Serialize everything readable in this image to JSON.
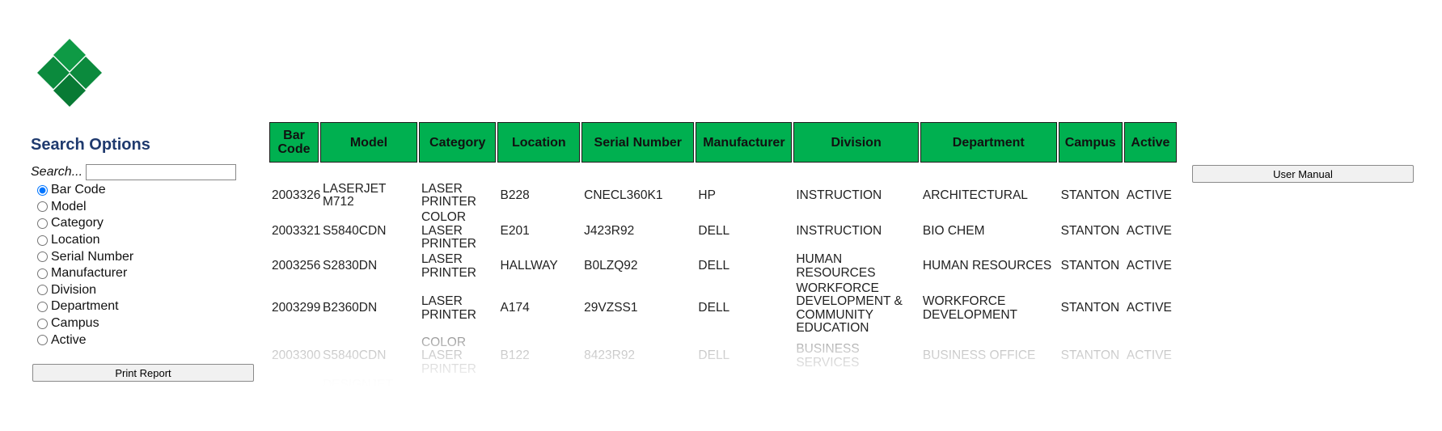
{
  "colors": {
    "header_green": "#00b050",
    "logo_green": "#0a8a3c",
    "title_blue": "#1f3a6e"
  },
  "logo": {
    "icon": "green-diamond-logo-icon"
  },
  "sidebar": {
    "title": "Search Options",
    "search_label": "Search...",
    "search_value": "",
    "options": [
      {
        "label": "Bar Code",
        "checked": true
      },
      {
        "label": "Model"
      },
      {
        "label": "Category"
      },
      {
        "label": "Location"
      },
      {
        "label": "Serial Number"
      },
      {
        "label": "Manufacturer"
      },
      {
        "label": "Division"
      },
      {
        "label": "Department"
      },
      {
        "label": "Campus"
      },
      {
        "label": "Active"
      }
    ],
    "print_label": "Print Report"
  },
  "manual_label": "User Manual",
  "table": {
    "headers": [
      "Bar Code",
      "Model",
      "Category",
      "Location",
      "Serial Number",
      "Manufacturer",
      "Division",
      "Department",
      "Campus",
      "Active"
    ],
    "rows": [
      [
        "2003326",
        "LASERJET M712",
        "LASER PRINTER",
        "B228",
        "CNECL360K1",
        "HP",
        "INSTRUCTION",
        "ARCHITECTURAL",
        "STANTON",
        "ACTIVE"
      ],
      [
        "2003321",
        "S5840CDN",
        "COLOR LASER PRINTER",
        "E201",
        "J423R92",
        "DELL",
        "INSTRUCTION",
        "BIO CHEM",
        "STANTON",
        "ACTIVE"
      ],
      [
        "2003256",
        "S2830DN",
        "LASER PRINTER",
        "HALLWAY",
        "B0LZQ92",
        "DELL",
        "HUMAN RESOURCES",
        "HUMAN RESOURCES",
        "STANTON",
        "ACTIVE"
      ],
      [
        "2003299",
        "B2360DN",
        "LASER PRINTER",
        "A174",
        "29VZSS1",
        "DELL",
        "WORKFORCE DEVELOPMENT & COMMUNITY EDUCATION",
        "WORKFORCE DEVELOPMENT",
        "STANTON",
        "ACTIVE"
      ],
      [
        "2003300",
        "S5840CDN",
        "COLOR LASER PRINTER",
        "B122",
        "8423R92",
        "DELL",
        "BUSINESS SERVICES",
        "BUSINESS OFFICE",
        "STANTON",
        "ACTIVE"
      ],
      [
        "",
        "DESIGNJET",
        "",
        "",
        "",
        "",
        "",
        "",
        "",
        ""
      ]
    ]
  }
}
